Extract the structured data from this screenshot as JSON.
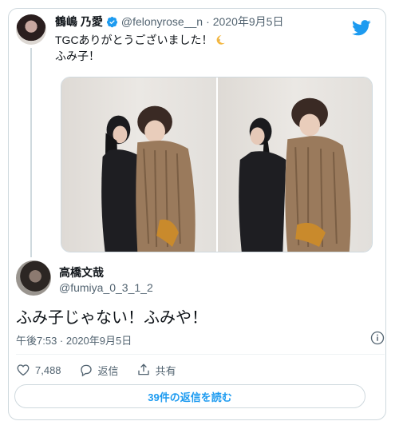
{
  "colors": {
    "accent": "#1d9bf0",
    "text": "#0f1419",
    "muted": "#536471",
    "border": "#cfd9de"
  },
  "icons": {
    "logo": "twitter-bird-icon",
    "verified": "verified-badge-icon",
    "like": "heart-icon",
    "reply": "speech-bubble-icon",
    "share": "share-icon",
    "info": "info-icon",
    "emoji": "crescent-moon-icon"
  },
  "parent_tweet": {
    "name": "鶴嶋 乃愛",
    "handle": "@felonyrose__n",
    "separator": "·",
    "date": "2020年9月5日",
    "text_line1": "TGCありがとうございました！",
    "text_line2": "ふみ子！"
  },
  "reply_tweet": {
    "name": "高橋文哉",
    "handle": "@fumiya_0_3_1_2",
    "text": "ふみ子じゃない！ふみや！",
    "timestamp": "午後7:53 · 2020年9月5日"
  },
  "actions": {
    "likes": "7,488",
    "reply_label": "返信",
    "share_label": "共有"
  },
  "read_replies_label": "39件の返信を読む"
}
